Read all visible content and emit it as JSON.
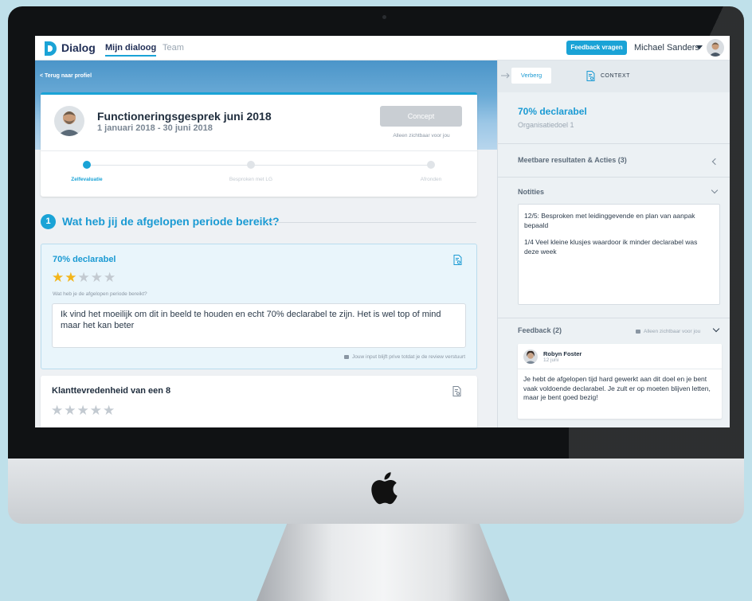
{
  "topbar": {
    "brand": "Dialog",
    "tab_active": "Mijn dialoog",
    "tab_team": "Team",
    "feedback_button": "Feedback vragen",
    "user_name": "Michael Sanders"
  },
  "header": {
    "back_link": "< Terug naar profiel",
    "title": "Functioneringsgesprek juni 2018",
    "date_range": "1 januari 2018 - 30 juni 2018",
    "status_button": "Concept",
    "visibility_note": "Alleen zichtbaar voor jou",
    "steps": [
      {
        "label": "Zelfevaluatie",
        "active": true
      },
      {
        "label": "Besproken met LG",
        "active": false
      },
      {
        "label": "Afronden",
        "active": false
      }
    ]
  },
  "question": {
    "number": "1",
    "title": "Wat heb jij de afgelopen periode bereikt?"
  },
  "goals": [
    {
      "title": "70% declarabel",
      "rating": 2,
      "max_rating": 5,
      "question": "Wat heb je de afgelopen periode bereikt?",
      "answer": "Ik vind het moeilijk om dit in beeld te houden en echt 70% declarabel te zijn. Het is wel top of mind maar het kan beter",
      "privacy": "Jouw input blijft prive totdat je de review verstuurt"
    },
    {
      "title": "Klanttevredenheid van een 8",
      "rating": 0,
      "max_rating": 5
    }
  ],
  "context": {
    "hide_button": "Verberg",
    "label": "CONTEXT",
    "goal_title": "70% declarabel",
    "goal_type": "Organisatiedoel 1",
    "results_section": "Meetbare resultaten & Acties (3)",
    "notes_section": "Notities",
    "notes": [
      "12/5: Besproken met leidinggevende en plan van aanpak bepaald",
      "1/4 Veel kleine klusjes waardoor ik minder declarabel was deze week"
    ],
    "feedback_section": "Feedback (2)",
    "feedback_visibility": "Alleen zichtbaar voor jou",
    "feedback": {
      "author": "Robyn Foster",
      "date": "12 juni",
      "text": "Je hebt de afgelopen tijd hard gewerkt aan dit doel en je bent vaak voldoende declarabel. Je zult er op moeten blijven letten, maar je bent goed bezig!"
    }
  },
  "colors": {
    "accent": "#1aa3d6",
    "brand_dark": "#1f2d55",
    "star_active": "#f3b51a",
    "star_inactive": "#c3cad1",
    "wall": "#bfe0ea"
  },
  "icons": [
    "dialog-logo-icon",
    "chevron-down-icon",
    "document-search-icon",
    "star-icon",
    "lock-icon",
    "arrow-right-icon",
    "chevron-left-icon",
    "apple-logo-icon"
  ]
}
